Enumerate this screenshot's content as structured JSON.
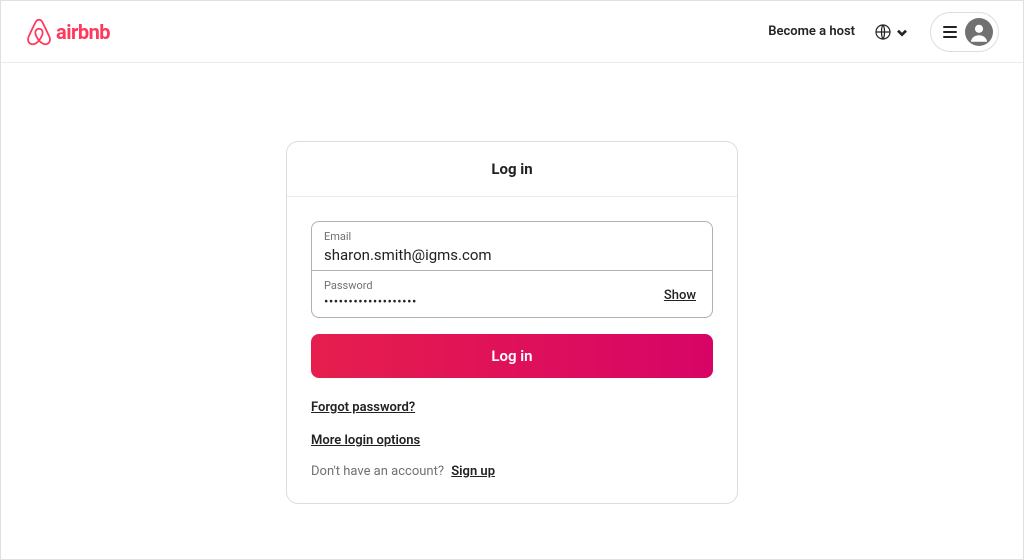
{
  "brand": {
    "name": "airbnb",
    "color": "#FF385C"
  },
  "header": {
    "become_host": "Become a host"
  },
  "login": {
    "title": "Log in",
    "email_label": "Email",
    "email_value": "sharon.smith@igms.com",
    "password_label": "Password",
    "password_mask": "•••••••••••••••••••",
    "show_label": "Show",
    "submit_label": "Log in",
    "forgot_label": "Forgot password?",
    "more_options_label": "More login options",
    "signup_prompt": "Don't have an account?",
    "signup_label": "Sign up"
  }
}
